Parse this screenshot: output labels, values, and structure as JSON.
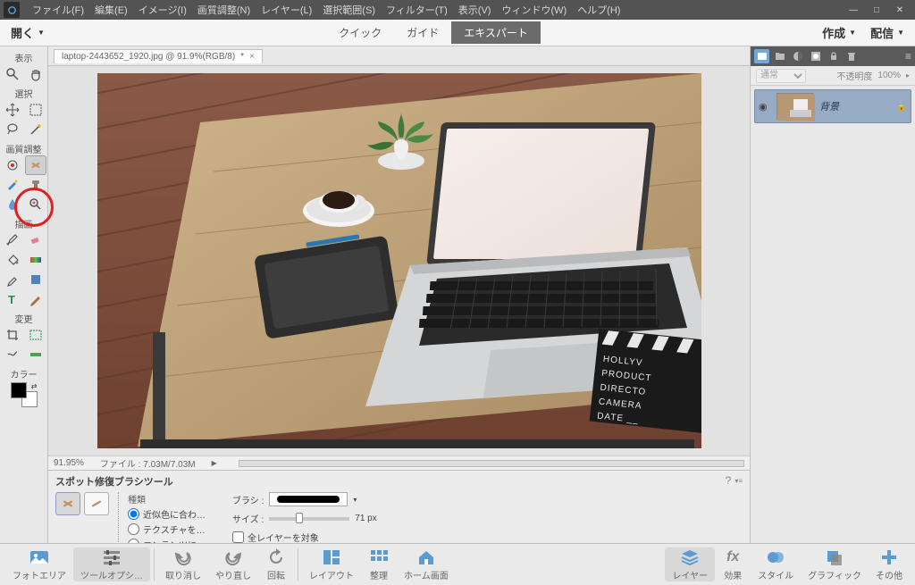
{
  "menubar": {
    "items": [
      "ファイル(F)",
      "編集(E)",
      "イメージ(I)",
      "画質調整(N)",
      "レイヤー(L)",
      "選択範囲(S)",
      "フィルター(T)",
      "表示(V)",
      "ウィンドウ(W)",
      "ヘルプ(H)"
    ]
  },
  "winctrl": {
    "min": "—",
    "max": "□",
    "close": "✕"
  },
  "modebar": {
    "open": "開く",
    "modes": [
      "クイック",
      "ガイド",
      "エキスパート"
    ],
    "active_index": 2,
    "create": "作成",
    "share": "配信"
  },
  "toolbox": {
    "sections": {
      "view": "表示",
      "select": "選択",
      "enhance": "画質調整",
      "draw": "描画",
      "modify": "変更",
      "color": "カラー"
    }
  },
  "document": {
    "tab_label": "laptop-2443652_1920.jpg @ 91.9%(RGB/8)",
    "tab_dirty": "*"
  },
  "status": {
    "zoom": "91.95%",
    "file": "ファイル",
    "size": "7.03M/7.03M"
  },
  "tooloptions": {
    "title": "スポット修復ブラシツール",
    "type_label": "種類",
    "radios": [
      "近似色に合わ…",
      "テクスチャを…",
      "コンテンツに…"
    ],
    "brush_label": "ブラシ :",
    "size_label": "サイズ :",
    "size_value": "71 px",
    "all_layers": "全レイヤーを対象"
  },
  "rightpanel": {
    "blend": "通常",
    "opacity_label": "不透明度",
    "opacity_value": "100%",
    "layer_name": "背景"
  },
  "bottombar": {
    "items_left": [
      "フォトエリア",
      "ツールオプシ…",
      "取り消し",
      "やり直し",
      "回転",
      "レイアウト",
      "整理",
      "ホーム画面"
    ],
    "items_right": [
      "レイヤー",
      "効果",
      "スタイル",
      "グラフィック",
      "その他"
    ]
  }
}
